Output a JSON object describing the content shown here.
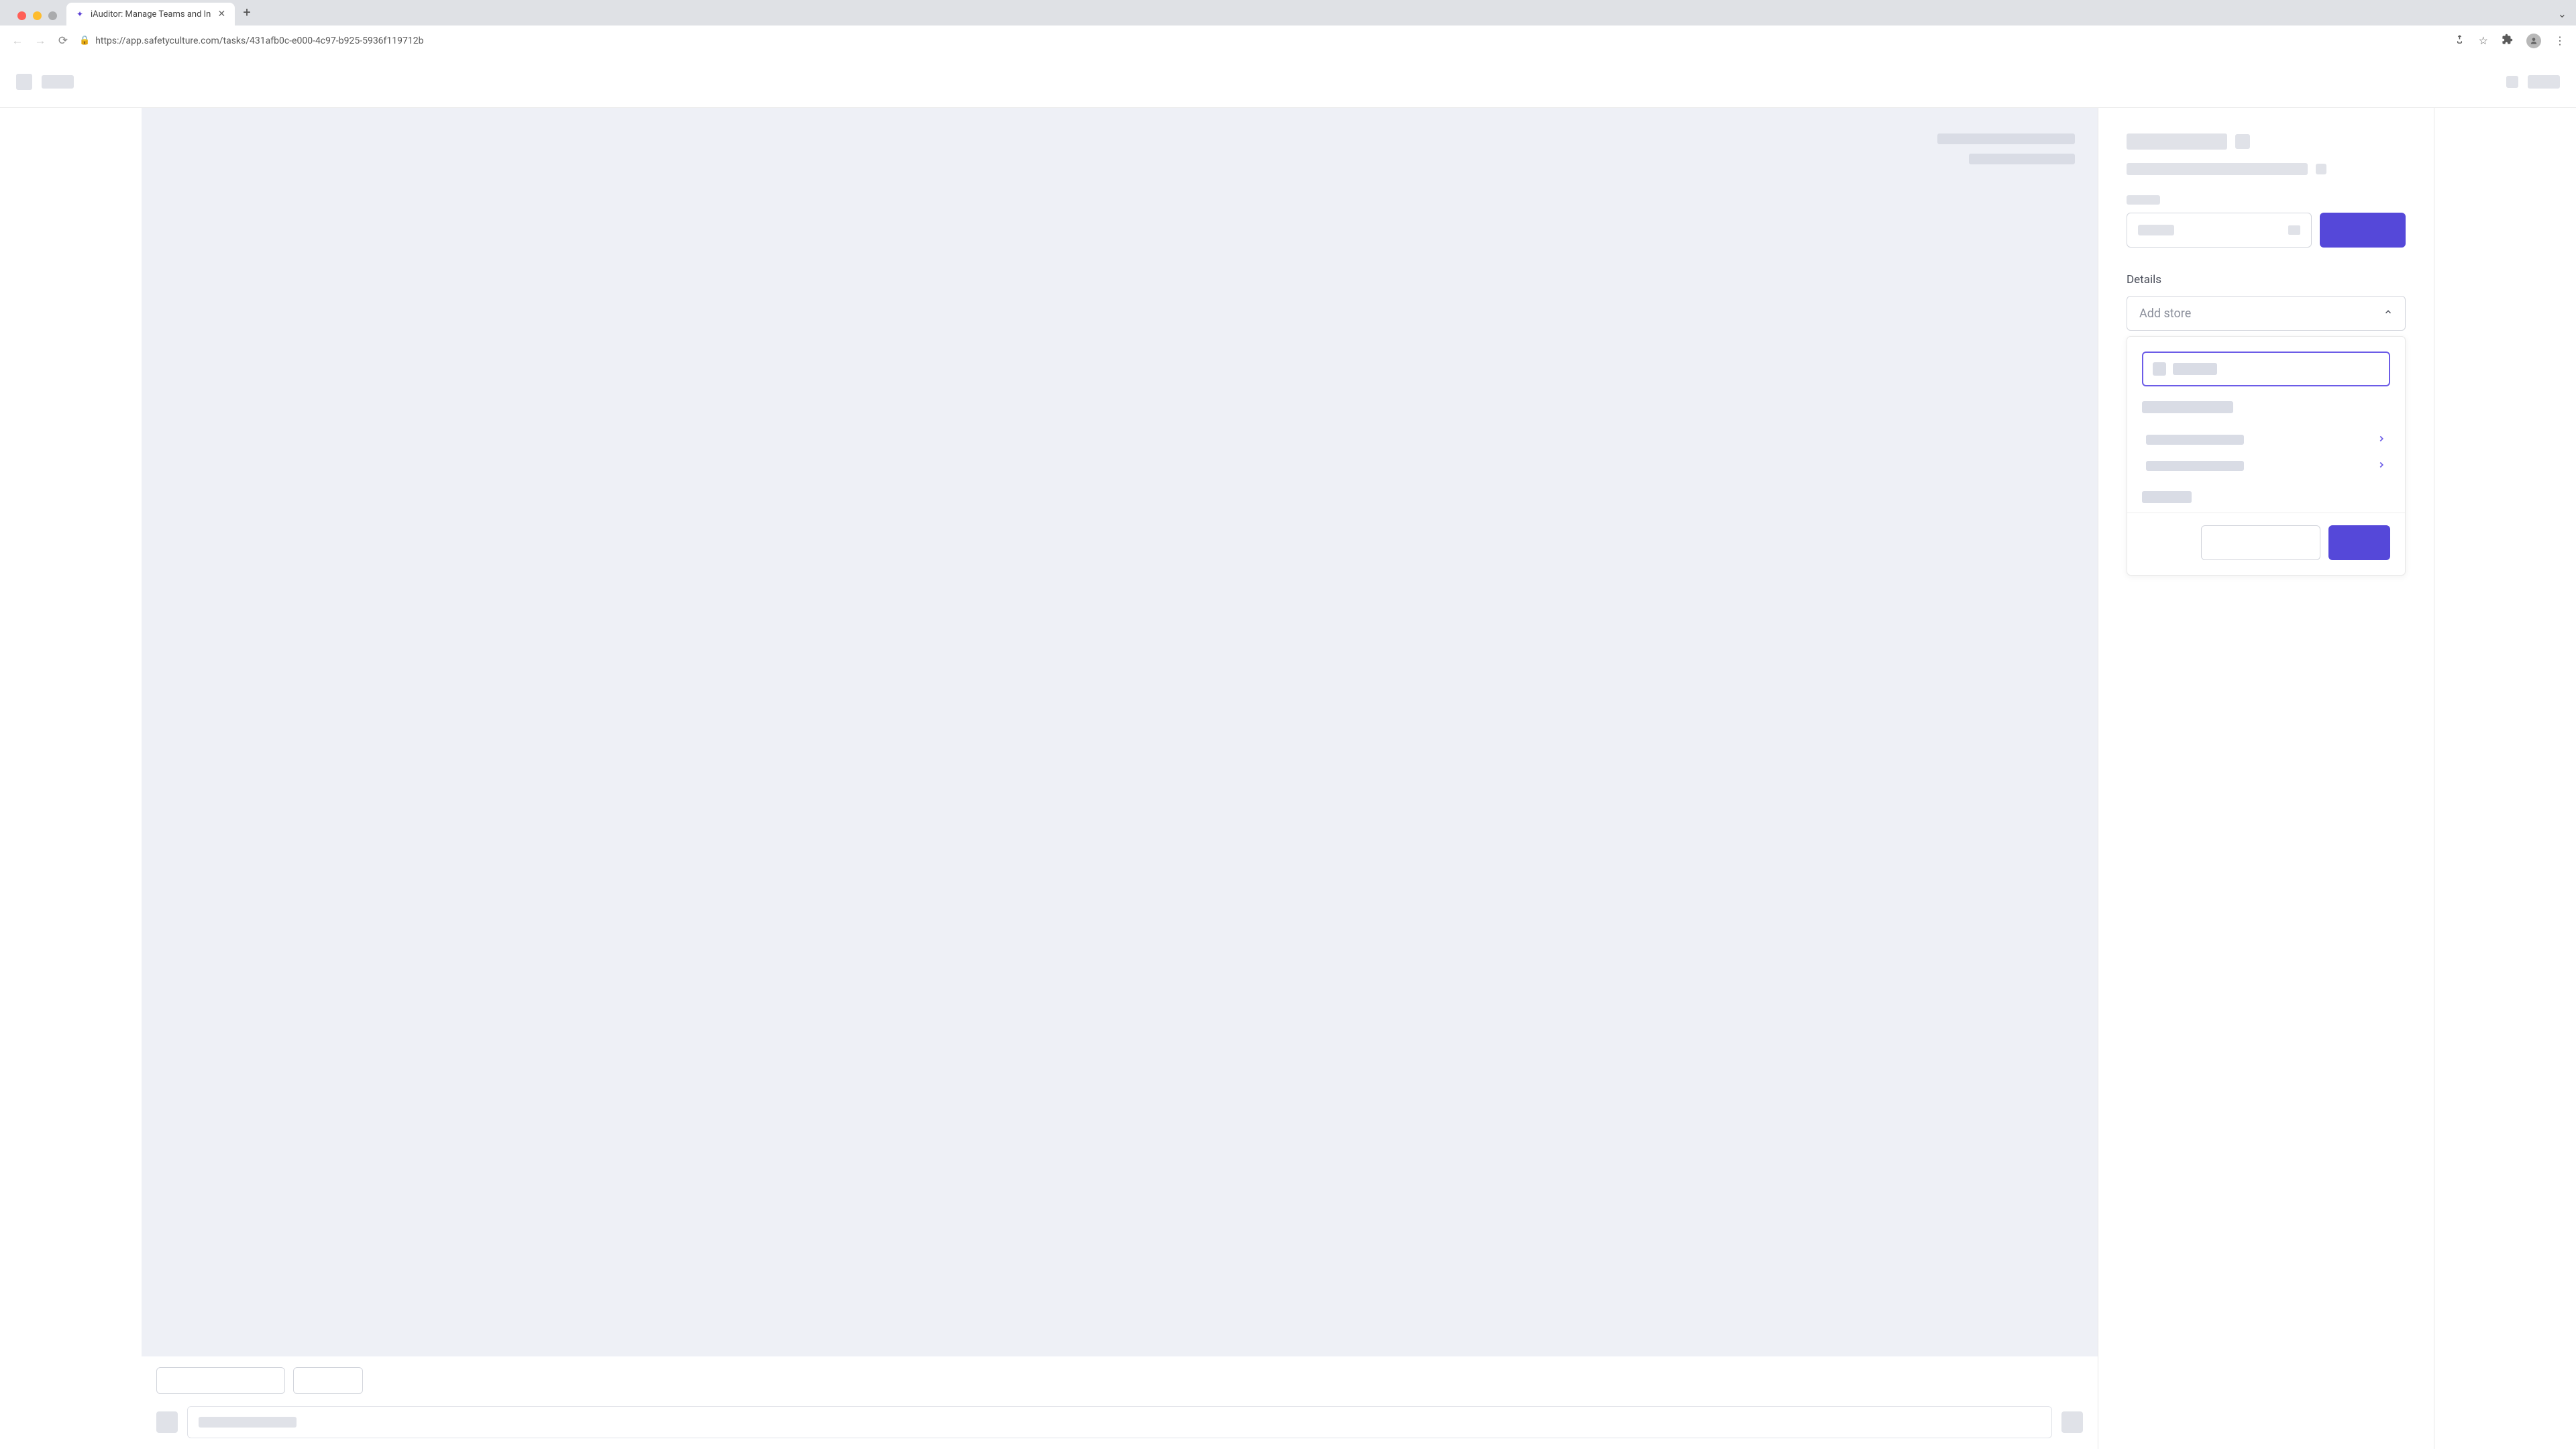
{
  "browser": {
    "tab_title": "iAuditor: Manage Teams and In",
    "url": "https://app.safetyculture.com/tasks/431afb0c-e000-4c97-b925-5936f119712b"
  },
  "right_panel": {
    "details_label": "Details",
    "add_store_placeholder": "Add store"
  },
  "colors": {
    "primary": "#5548d9",
    "skeleton": "#e0e2e8",
    "canvas_bg": "#eef0f6"
  }
}
